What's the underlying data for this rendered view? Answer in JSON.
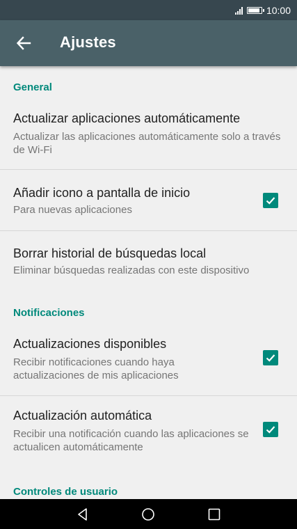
{
  "status_bar": {
    "time": "10:00",
    "battery_level": 0.9,
    "signal_bars": 4
  },
  "app_bar": {
    "title": "Ajustes",
    "back_icon": "arrow-back-icon"
  },
  "sections": {
    "general": {
      "header": "General",
      "items": [
        {
          "title": "Actualizar aplicaciones automáticamente",
          "subtitle": "Actualizar las aplicaciones automáticamente solo a través de Wi-Fi"
        },
        {
          "title": "Añadir icono a pantalla de inicio",
          "subtitle": "Para nuevas aplicaciones",
          "checked": true
        },
        {
          "title": "Borrar historial de búsquedas  local",
          "subtitle": "Eliminar búsquedas realizadas con este dispositivo"
        }
      ]
    },
    "notifications": {
      "header": "Notificaciones",
      "items": [
        {
          "title": "Actualizaciones disponibles",
          "subtitle": "Recibir notificaciones cuando haya actualizaciones de mis aplicaciones",
          "checked": true
        },
        {
          "title": "Actualización automática",
          "subtitle": "Recibir una notificación cuando las aplicaciones se actualicen automáticamente",
          "checked": true
        }
      ]
    },
    "user_controls": {
      "header": "Controles de usuario"
    }
  },
  "nav_bar": {
    "back": "triangle-back-icon",
    "home": "circle-home-icon",
    "recents": "square-recents-icon"
  },
  "colors": {
    "accent": "#00897b",
    "app_bar": "#4a6168",
    "status_bar": "#37474f"
  }
}
